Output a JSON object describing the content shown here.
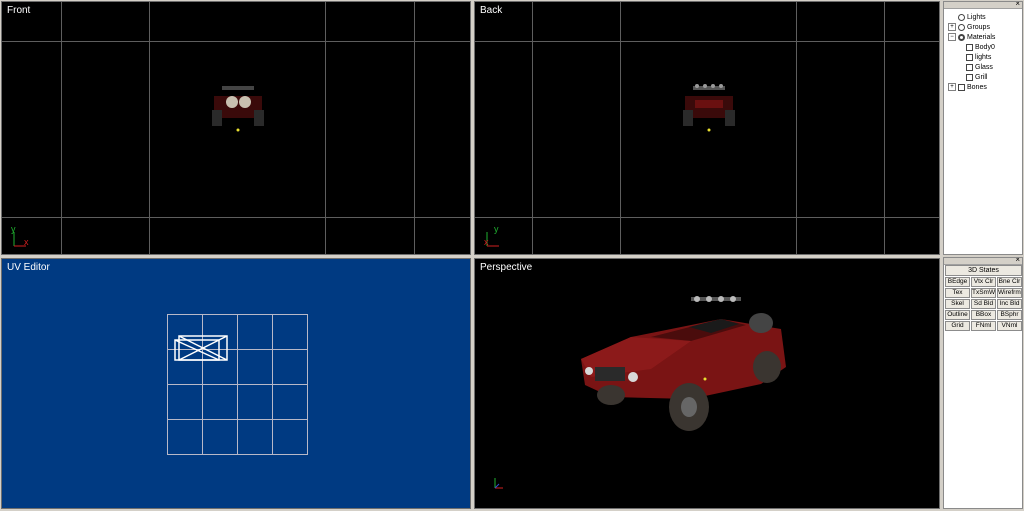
{
  "viewports": {
    "front": {
      "title": "Front"
    },
    "back": {
      "title": "Back"
    },
    "uv": {
      "title": "UV Editor"
    },
    "perspective": {
      "title": "Perspective"
    }
  },
  "axis_labels": {
    "x": "x",
    "y": "y"
  },
  "tree": {
    "items": [
      {
        "label": "Lights",
        "icon": "light-icon",
        "expander": ""
      },
      {
        "label": "Groups",
        "icon": "groups-icon",
        "expander": "+"
      },
      {
        "label": "Materials",
        "icon": "materials-icon",
        "expander": "−"
      },
      {
        "label": "Body0",
        "icon": "texture-icon",
        "expander": ""
      },
      {
        "label": "lights",
        "icon": "texture-icon",
        "expander": ""
      },
      {
        "label": "Glass",
        "icon": "texture-icon",
        "expander": ""
      },
      {
        "label": "Grill",
        "icon": "texture-icon",
        "expander": ""
      },
      {
        "label": "Bones",
        "icon": "bones-icon",
        "expander": "+"
      }
    ]
  },
  "states_panel": {
    "title_button": "3D States",
    "buttons": [
      [
        "BEdge",
        "Vtx Clr",
        "Bne Clr"
      ],
      [
        "Tex Smi",
        "TxSmWr",
        "Wirefrme"
      ],
      [
        "Skel",
        "Sd Bld",
        "Inc Bld"
      ],
      [
        "Outline",
        "BBox",
        "BSphr"
      ],
      [
        "Grid",
        "FNml",
        "VNml"
      ]
    ]
  },
  "colors": {
    "viewport_bg": "#000000",
    "uv_bg": "#003a82",
    "grid": "#5e5e5e",
    "truck_red": "#7a1414",
    "axis_x": "#d02020",
    "axis_y": "#20b030"
  }
}
